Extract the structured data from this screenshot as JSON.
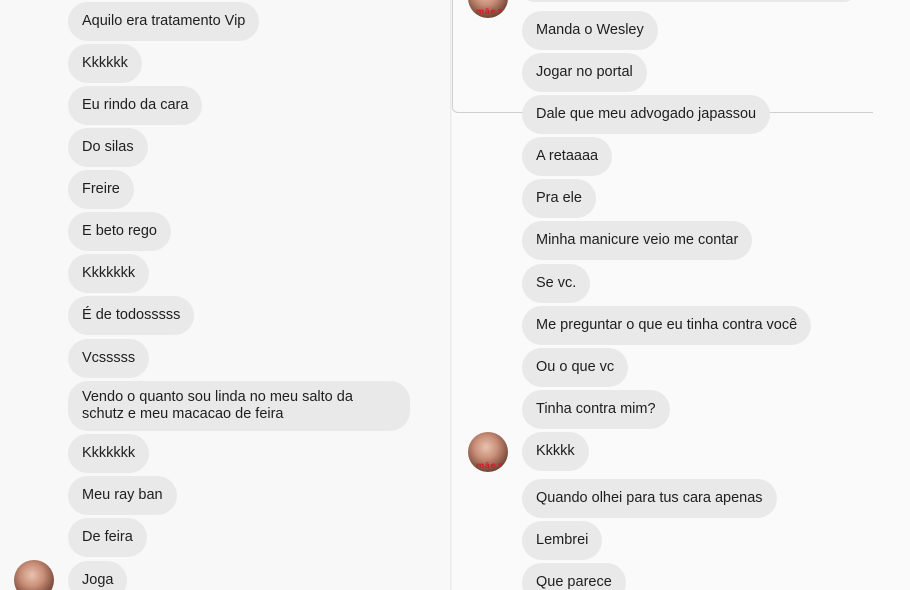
{
  "left_messages": [
    "Aquilo era tratamento Vip",
    "Kkkkkk",
    "Eu rindo da cara",
    "Do silas",
    "Freire",
    "E beto rego",
    "Kkkkkkk",
    "É de todosssss",
    "Vcsssss",
    "Vendo o quanto sou linda no meu salto da schutz e meu macacao de feira",
    "Kkkkkkk",
    "Meu ray ban",
    "De feira",
    "Joga"
  ],
  "right_messages": [
    "Manda o Wesley",
    "Jogar no portal",
    "Dale que meu advogado japassou",
    "A retaaaa",
    "Pra ele",
    "Minha manicure veio me contar",
    "Se vc.",
    "Me preguntar o que eu tinha contra você",
    "Ou o que vc",
    "Tinha contra mim?",
    "Kkkkk",
    "Quando olhei para tus cara apenas",
    "Lembrei",
    "Que parece"
  ],
  "avatar": {
    "tag": "mãe",
    "icon": "profile-photo",
    "accent_color": "#d31b2b"
  },
  "colors": {
    "bubble": "#e9e9e9",
    "background": "#f7f7f7",
    "text": "#1e1e1e"
  }
}
